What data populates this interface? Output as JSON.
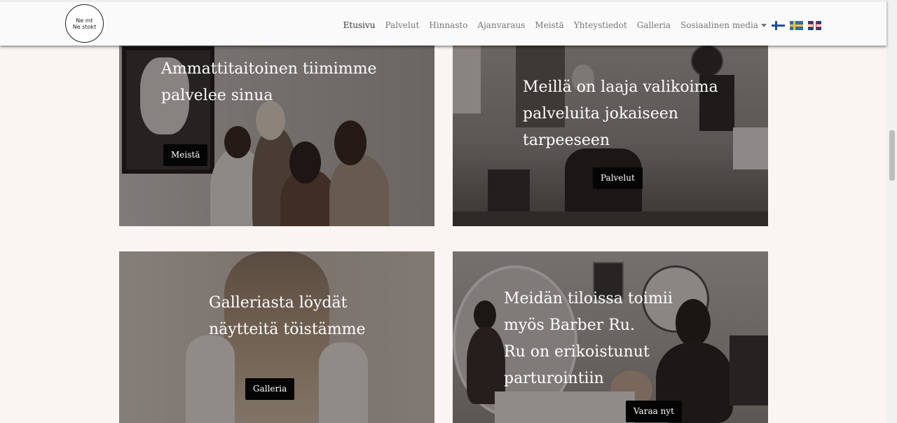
{
  "logo": {
    "line1": "Ne mt",
    "line2": "Ne stokt"
  },
  "nav": {
    "items": [
      {
        "label": "Etusivu",
        "active": true
      },
      {
        "label": "Palvelut"
      },
      {
        "label": "Hinnasto"
      },
      {
        "label": "Ajanvaraus"
      },
      {
        "label": "Meistä"
      },
      {
        "label": "Yhteystiedot"
      },
      {
        "label": "Galleria"
      },
      {
        "label": "Sosiaalinen media"
      }
    ],
    "flags": [
      "finnish-flag",
      "swedish-flag",
      "uk-flag"
    ]
  },
  "cards": {
    "team": {
      "lines": [
        "Ammattitaitoinen tiimimme",
        "palvelee sinua"
      ],
      "button": "Meistä"
    },
    "services": {
      "lines": [
        "Meillä on laaja valikoima",
        "palveluita jokaiseen",
        "tarpeeseen"
      ],
      "button": "Palvelut"
    },
    "gallery": {
      "lines": [
        "Galleriasta löydät",
        "näytteitä töistämme"
      ],
      "button": "Galleria"
    },
    "barber": {
      "lines": [
        "Meidän tiloissa toimii",
        "myös Barber Ru.",
        "Ru on erikoistunut",
        "parturointiin"
      ],
      "button": "Varaa nyt"
    }
  }
}
